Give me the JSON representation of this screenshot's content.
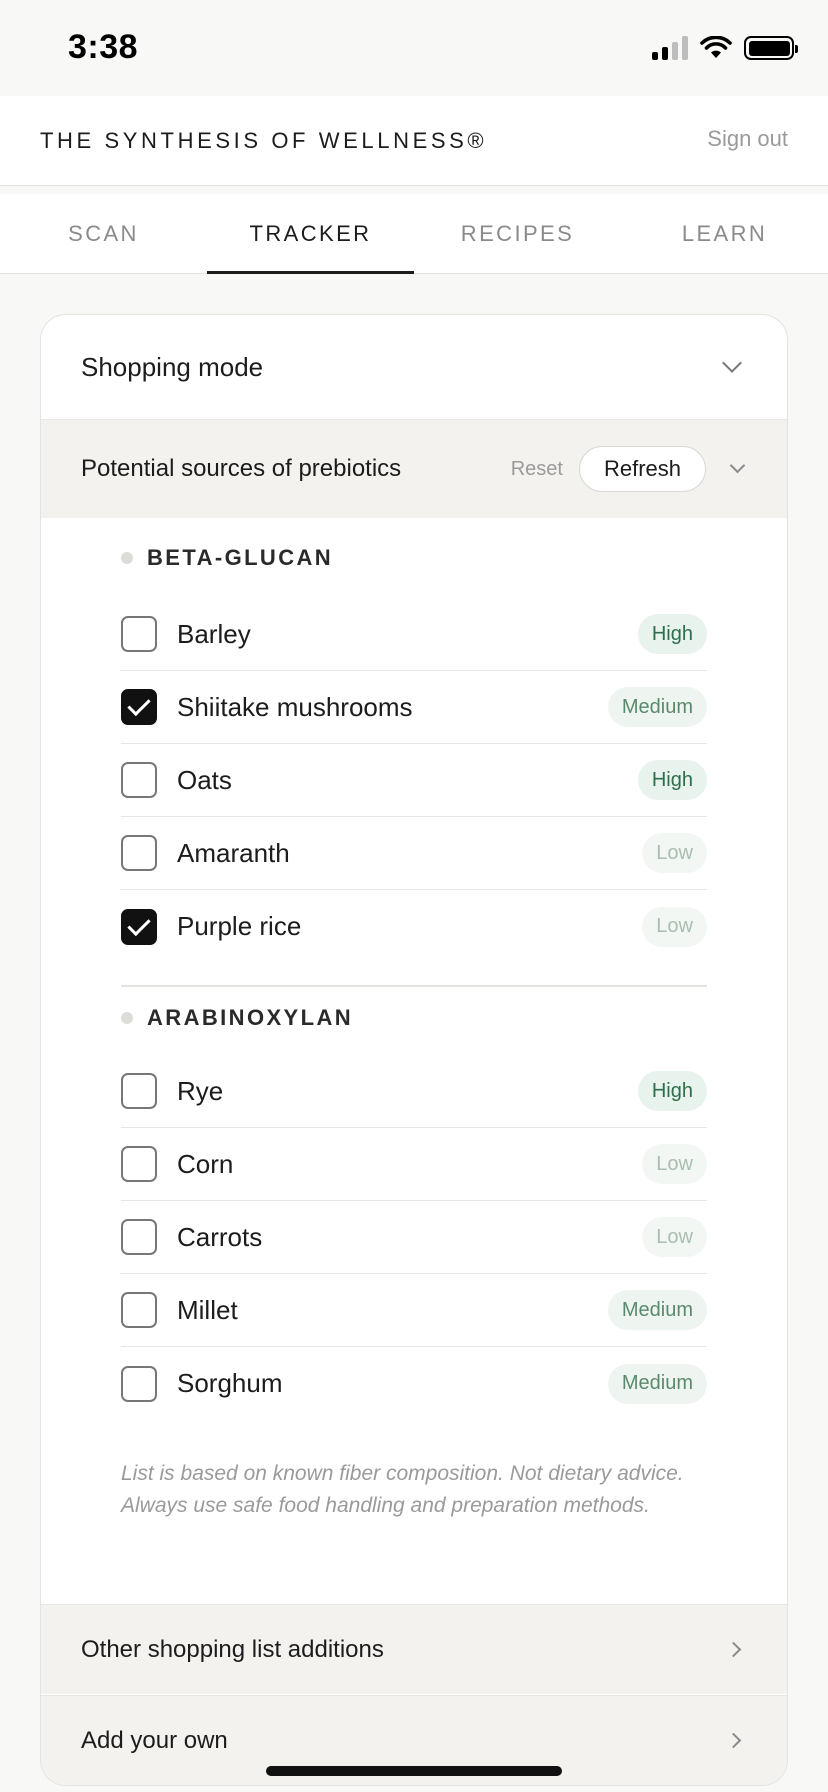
{
  "status": {
    "time": "3:38"
  },
  "header": {
    "brand": "THE SYNTHESIS OF WELLNESS®",
    "signout": "Sign out"
  },
  "tabs": [
    {
      "label": "SCAN",
      "active": false
    },
    {
      "label": "TRACKER",
      "active": true
    },
    {
      "label": "RECIPES",
      "active": false
    },
    {
      "label": "LEARN",
      "active": false
    }
  ],
  "card": {
    "title": "Shopping mode",
    "section": {
      "title": "Potential sources of prebiotics",
      "reset": "Reset",
      "refresh": "Refresh"
    },
    "groups": [
      {
        "title": "BETA-GLUCAN",
        "items": [
          {
            "label": "Barley",
            "level": "High",
            "checked": false
          },
          {
            "label": "Shiitake mushrooms",
            "level": "Medium",
            "checked": true
          },
          {
            "label": "Oats",
            "level": "High",
            "checked": false
          },
          {
            "label": "Amaranth",
            "level": "Low",
            "checked": false
          },
          {
            "label": "Purple rice",
            "level": "Low",
            "checked": true
          }
        ]
      },
      {
        "title": "ARABINOXYLAN",
        "items": [
          {
            "label": "Rye",
            "level": "High",
            "checked": false
          },
          {
            "label": "Corn",
            "level": "Low",
            "checked": false
          },
          {
            "label": "Carrots",
            "level": "Low",
            "checked": false
          },
          {
            "label": "Millet",
            "level": "Medium",
            "checked": false
          },
          {
            "label": "Sorghum",
            "level": "Medium",
            "checked": false
          }
        ]
      }
    ],
    "disclaimer": "List is based on known fiber composition. Not dietary advice. Always use safe food handling and preparation methods.",
    "links": [
      {
        "label": "Other shopping list additions"
      },
      {
        "label": "Add your own"
      }
    ]
  }
}
